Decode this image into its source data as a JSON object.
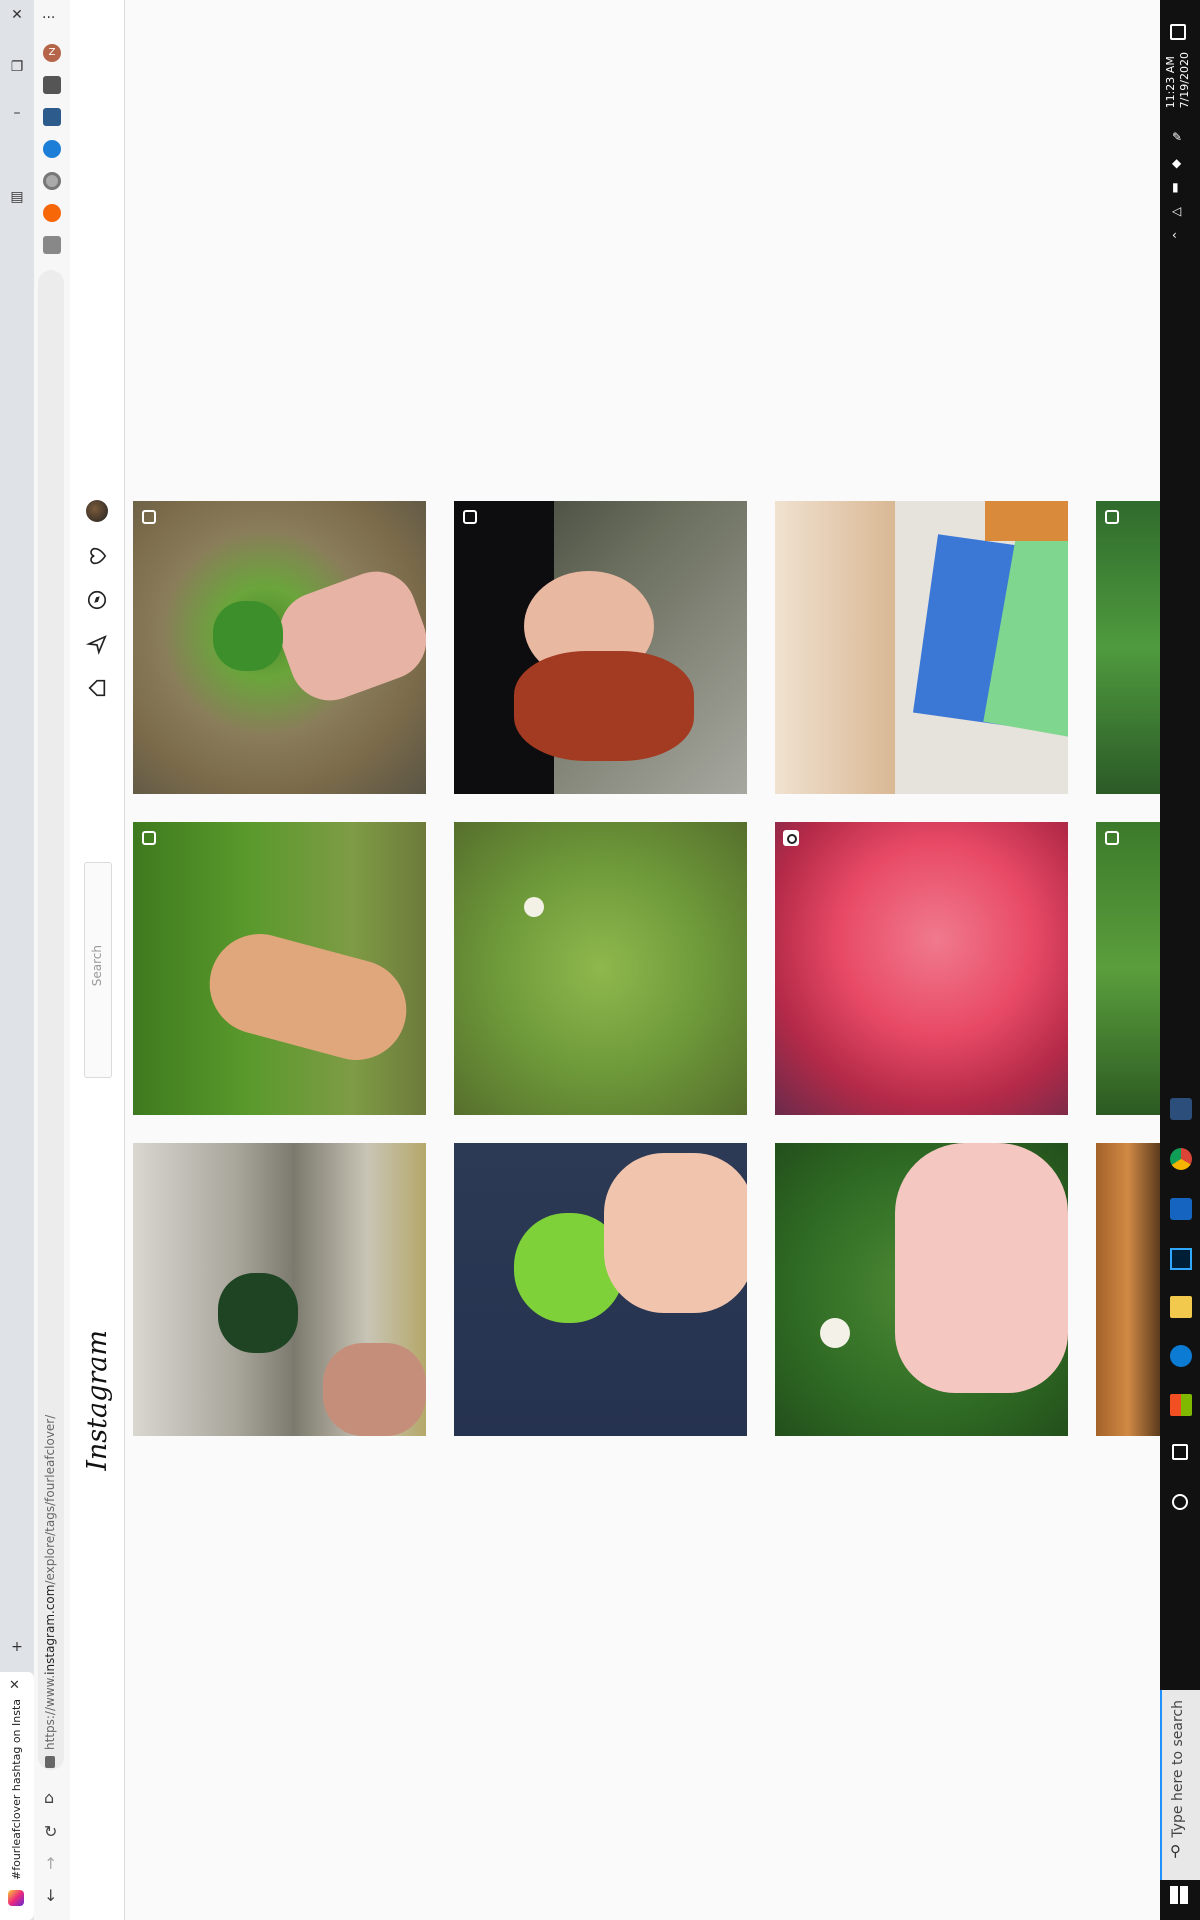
{
  "browser": {
    "tab_title": "#fourleafclover hashtag on Insta...",
    "url_prefix": "https://www.",
    "url_domain": "instagram.com",
    "url_path": "/explore/tags/fourleafclover/",
    "profile_initial": "Z",
    "menu_dots": "···"
  },
  "instagram": {
    "logo": "Instagram",
    "search_placeholder": "Search"
  },
  "taskbar": {
    "search_placeholder": "Type here to search",
    "time": "11:23 AM",
    "date": "7/19/2020"
  },
  "grid": {
    "rows": [
      [
        "four leaf clover in hand",
        "smiling woman with red hair",
        "cat with paper clover cards",
        "clover leaves"
      ],
      [
        "hand holding clover in grass",
        "clover patch in grass",
        "red blurred video",
        "green clover leaves"
      ],
      [
        "dark clover over stone",
        "shamrock held in fingers",
        "clover on palm",
        "glass jar"
      ]
    ],
    "badges": [
      [
        "multi",
        "multi",
        "none",
        "multi"
      ],
      [
        "multi",
        "none",
        "video",
        "multi"
      ],
      [
        "none",
        "none",
        "none",
        "none"
      ]
    ]
  },
  "colors": {
    "accent": "#1e90ff",
    "taskbar": "#111111",
    "ig_border": "#dbdbdb"
  }
}
